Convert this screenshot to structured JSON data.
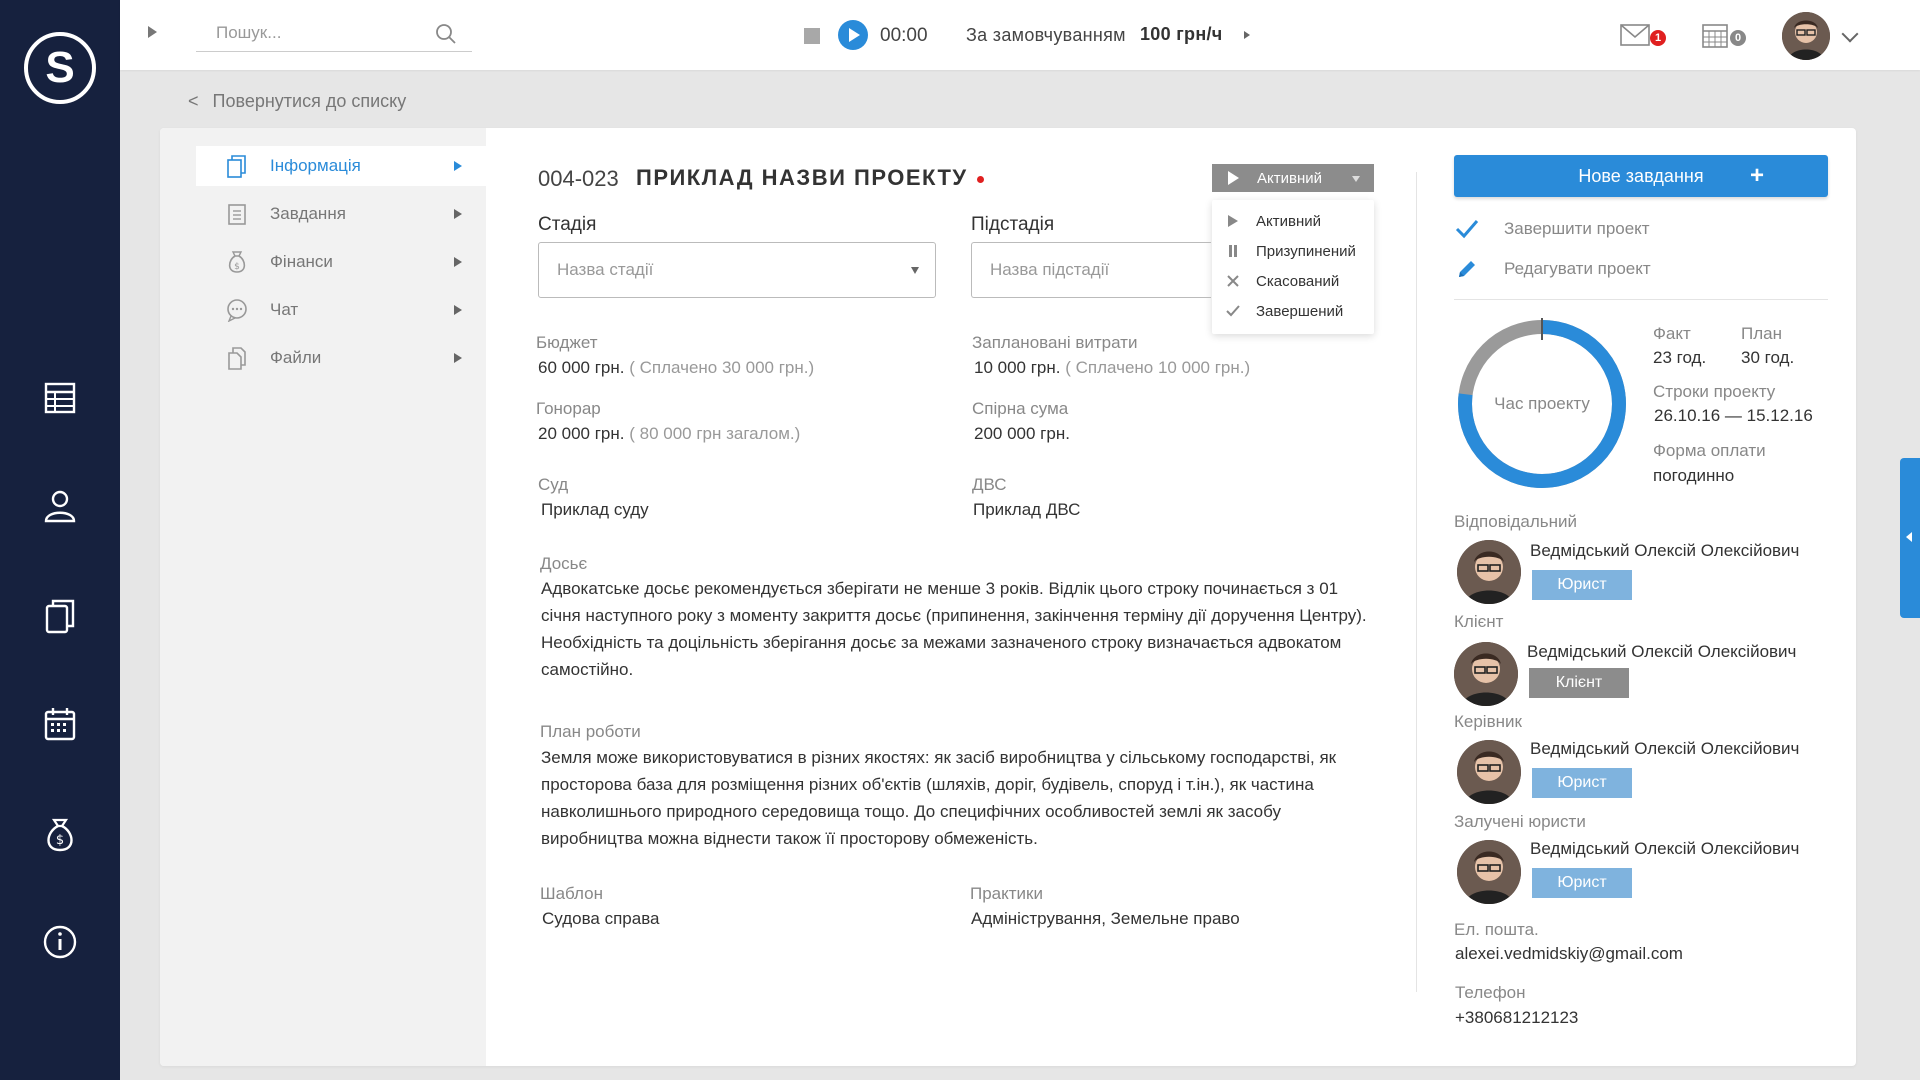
{
  "app": {
    "logo_letter": "S"
  },
  "leftbar": {
    "icons": [
      "table-icon",
      "user-icon",
      "documents-icon",
      "calendar-icon",
      "money-bag-icon",
      "info-icon"
    ]
  },
  "topbar": {
    "search_placeholder": "Пошук...",
    "timer": "00:00",
    "rate_label": "За замовчуванням",
    "rate_value": "100 грн/ч",
    "mail_count": "1",
    "calendar_count": "0"
  },
  "back_link": {
    "arrow": "<",
    "label": "Повернутися до списку"
  },
  "side_nav": [
    {
      "label": "Інформація",
      "icon": "info-doc-icon",
      "active": true
    },
    {
      "label": "Завдання",
      "icon": "tasks-icon",
      "active": false
    },
    {
      "label": "Фінанси",
      "icon": "money-bag-icon",
      "active": false
    },
    {
      "label": "Чат",
      "icon": "chat-icon",
      "active": false
    },
    {
      "label": "Файли",
      "icon": "files-icon",
      "active": false
    }
  ],
  "project": {
    "code": "004-023",
    "title": "ПРИКЛАД НАЗВИ ПРОЕКТУ",
    "status": "Активний",
    "status_options": [
      {
        "label": "Активний",
        "icon": "play-icon"
      },
      {
        "label": "Призупинений",
        "icon": "pause-icon"
      },
      {
        "label": "Скасований",
        "icon": "cross-icon"
      },
      {
        "label": "Завершений",
        "icon": "check-icon"
      }
    ],
    "stage_label": "Стадія",
    "stage_placeholder": "Назва стадії",
    "substage_label": "Підстадія",
    "substage_placeholder": "Назва підстадії",
    "budget_label": "Бюджет",
    "budget_value": "60 000 грн.",
    "budget_note": "( Сплачено 30 000 грн.)",
    "planned_label": "Заплановані витрати",
    "planned_value": "10 000 грн.",
    "planned_note": "( Сплачено 10 000 грн.)",
    "fee_label": "Гонорар",
    "fee_value": "20 000 грн.",
    "fee_note": "( 80 000 грн загалом.)",
    "dispute_label": "Спірна сума",
    "dispute_value": "200 000 грн.",
    "court_label": "Суд",
    "court_value": "Приклад суду",
    "dvs_label": "ДВС",
    "dvs_value": "Приклад ДВС",
    "dossier_label": "Досьє",
    "dossier_text": "Адвокатське досьє рекомендується зберігати не менше 3 років. Відлік цього строку починається з 01 січня наступного року з моменту закриття досьє (припинення, закінчення терміну дії доручення Центру). Необхідність та доцільність зберігання досьє за межами зазначеного строку визначається адвокатом самостійно.",
    "plan_label": "План роботи",
    "plan_text": "Земля може використовуватися в різних якостях: як засіб виробництва у сільському господарстві, як просторова база для розміщення різних об'єктів (шляхів, доріг, будівель, споруд і т.ін.), як частина навколишнього природного середовища тощо. До специфічних особливостей землі як засобу виробництва можна віднести також її просторову обмеженість.",
    "template_label": "Шаблон",
    "template_value": "Судова справа",
    "practices_label": "Практики",
    "practices_value": "Адміністрування, Земельне право"
  },
  "right_panel": {
    "new_task": "Нове завдання",
    "new_task_plus": "+",
    "complete_project": "Завершити проект",
    "edit_project": "Редагувати проект",
    "donut_label": "Час проекту",
    "donut_fill_fraction": 0.77,
    "fact_label": "Факт",
    "fact_value": "23 год.",
    "plan_label": "План",
    "plan_value": "30 год.",
    "terms_label": "Строки проекту",
    "terms_value": "26.10.16 — 15.12.16",
    "payment_label": "Форма оплати",
    "payment_value": "погодинно",
    "people": [
      {
        "section": "Відповідальний",
        "name": "Ведмідський Олексій Олексійович",
        "role": "Юрист"
      },
      {
        "section": "Клієнт",
        "name": "Ведмідський Олексій Олексійович",
        "role": "Клієнт"
      },
      {
        "section": "Керівник",
        "name": "Ведмідський Олексій Олексійович",
        "role": "Юрист"
      },
      {
        "section": "Залучені юристи",
        "name": "Ведмідський Олексій Олексійович",
        "role": "Юрист"
      }
    ],
    "email_label": "Ел. пошта.",
    "email_value": "alexei.vedmidskiy@gmail.com",
    "phone_label": "Телефон",
    "phone_value": "+380681212123"
  },
  "colors": {
    "accent": "#2a8bd9",
    "sidebar": "#16213e",
    "role_lawyer": "#7fb3de",
    "role_client": "#8c8c8c",
    "alert": "#e02020"
  }
}
